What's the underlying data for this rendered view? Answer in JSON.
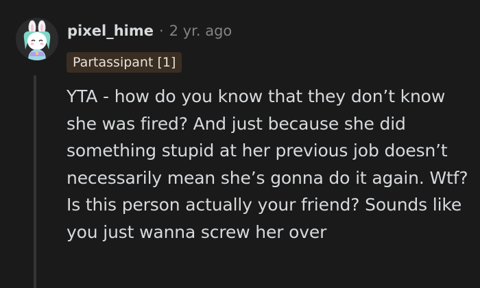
{
  "comment": {
    "username": "pixel_hime",
    "separator": "·",
    "timestamp": "2 yr. ago",
    "flair": "Partassipant [1]",
    "avatar_icon": "bunny-avatar-icon",
    "body": "YTA - how do you know that they don’t know she was fired? And just because she did something stupid at her previous job doesn’t necessarily mean she’s gonna do it again. Wtf? Is this person actually your friend? Sounds like you just wanna screw her over"
  },
  "colors": {
    "background": "#1a1a1b",
    "text": "#d7dadc",
    "meta": "#818384",
    "flair_bg": "#3a2d22",
    "thread_line": "#343536"
  }
}
